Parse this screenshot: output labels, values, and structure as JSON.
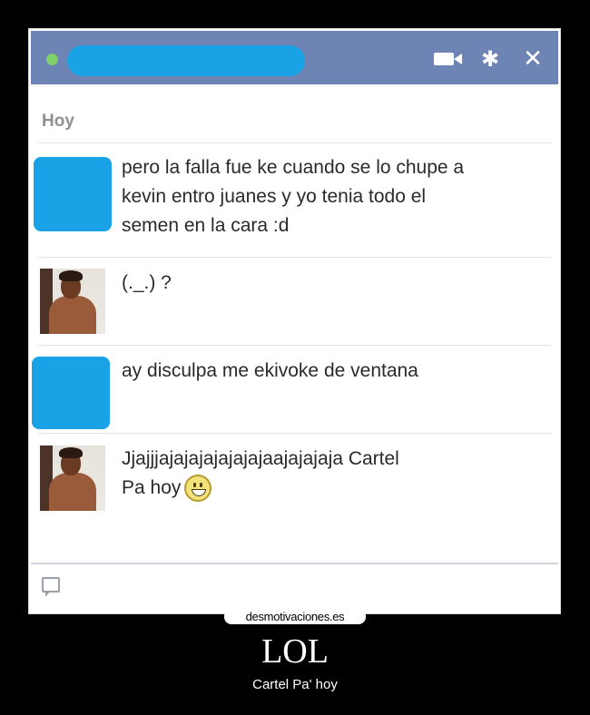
{
  "chat": {
    "day_label": "Hoy",
    "messages": [
      {
        "sender": "blurred",
        "lines": [
          "pero la falla fue ke cuando se lo chupe a",
          "kevin entro juanes y yo tenia todo el",
          "semen en la cara :d"
        ]
      },
      {
        "sender": "photo",
        "lines": [
          "(._.) ?"
        ]
      },
      {
        "sender": "blurred",
        "lines": [
          "ay disculpa me ekivoke de ventana"
        ]
      },
      {
        "sender": "photo",
        "lines": [
          "Jjajjjajajajajajajajaajajajaja Cartel",
          "Pa hoy"
        ]
      }
    ]
  },
  "header": {
    "icons": [
      "video-camera-icon",
      "gear-icon",
      "close-icon"
    ],
    "close_glyph": "✕",
    "gear_glyph": "✱",
    "accent_color": "#6d84b4"
  },
  "watermark": "desmotivaciones.es",
  "poster": {
    "title": "LOL",
    "caption": "Cartel Pa' hoy"
  }
}
